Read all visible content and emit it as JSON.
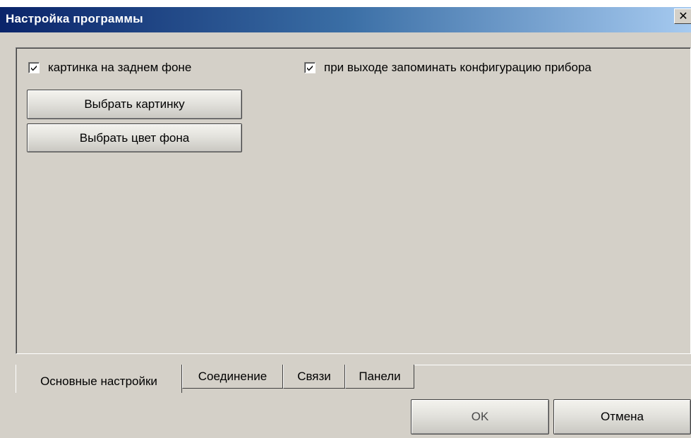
{
  "window": {
    "title": "Настройка программы",
    "close_glyph": "✕"
  },
  "general": {
    "bg_image_checkbox": {
      "label": "картинка на заднем фоне",
      "checked": true
    },
    "remember_config_checkbox": {
      "label": "при выходе запоминать конфигурацию прибора",
      "checked": true
    },
    "choose_image_button": "Выбрать картинку",
    "choose_bg_color_button": "Выбрать цвет фона"
  },
  "tabs": [
    {
      "label": "Основные настройки",
      "active": true
    },
    {
      "label": "Соединение",
      "active": false
    },
    {
      "label": "Связи",
      "active": false
    },
    {
      "label": "Панели",
      "active": false
    }
  ],
  "footer": {
    "ok_label": "OK",
    "cancel_label": "Отмена"
  },
  "colors": {
    "window_bg": "#d4d0c8",
    "title_gradient_start": "#0a246a",
    "title_gradient_end": "#a6caf0"
  },
  "icons": {
    "check": "checkmark-icon",
    "close": "close-icon"
  }
}
